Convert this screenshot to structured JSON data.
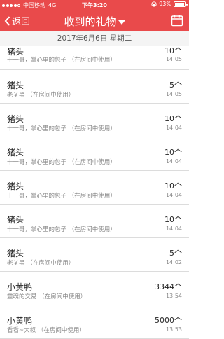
{
  "status_bar": {
    "carrier": "中国移动",
    "network": "4G",
    "time": "下午3:20",
    "battery": "93%",
    "battery_level": 0.93
  },
  "nav": {
    "back_label": "返回",
    "title": "收到的礼物"
  },
  "date": "2017年6月6日 星期二",
  "gifts": [
    {
      "name": "猪头",
      "desc": "十一哥，掌心里的包子 （在房间中使用）",
      "count": "10个",
      "time": "14:05"
    },
    {
      "name": "猪头",
      "desc": "老￥黑 （在房间中使用）",
      "count": "5个",
      "time": "14:05"
    },
    {
      "name": "猪头",
      "desc": "十一哥，掌心里的包子 （在房间中使用）",
      "count": "10个",
      "time": "14:04"
    },
    {
      "name": "猪头",
      "desc": "十一哥，掌心里的包子 （在房间中使用）",
      "count": "10个",
      "time": "14:04"
    },
    {
      "name": "猪头",
      "desc": "十一哥，掌心里的包子 （在房间中使用）",
      "count": "10个",
      "time": "14:04"
    },
    {
      "name": "猪头",
      "desc": "十一哥，掌心里的包子 （在房间中使用）",
      "count": "10个",
      "time": "14:04"
    },
    {
      "name": "猪头",
      "desc": "老￥黑 （在房间中使用）",
      "count": "5个",
      "time": "14:02"
    },
    {
      "name": "小黄鸭",
      "desc": "靈魂的交易 （在房间中使用）",
      "count": "3344个",
      "time": "13:54"
    },
    {
      "name": "小黄鸭",
      "desc": "看看~大叔 （在房间中使用）",
      "count": "5000个",
      "time": "13:53"
    }
  ],
  "colors": {
    "header": "#e94a4b",
    "datebar": "#f4f4f4"
  }
}
